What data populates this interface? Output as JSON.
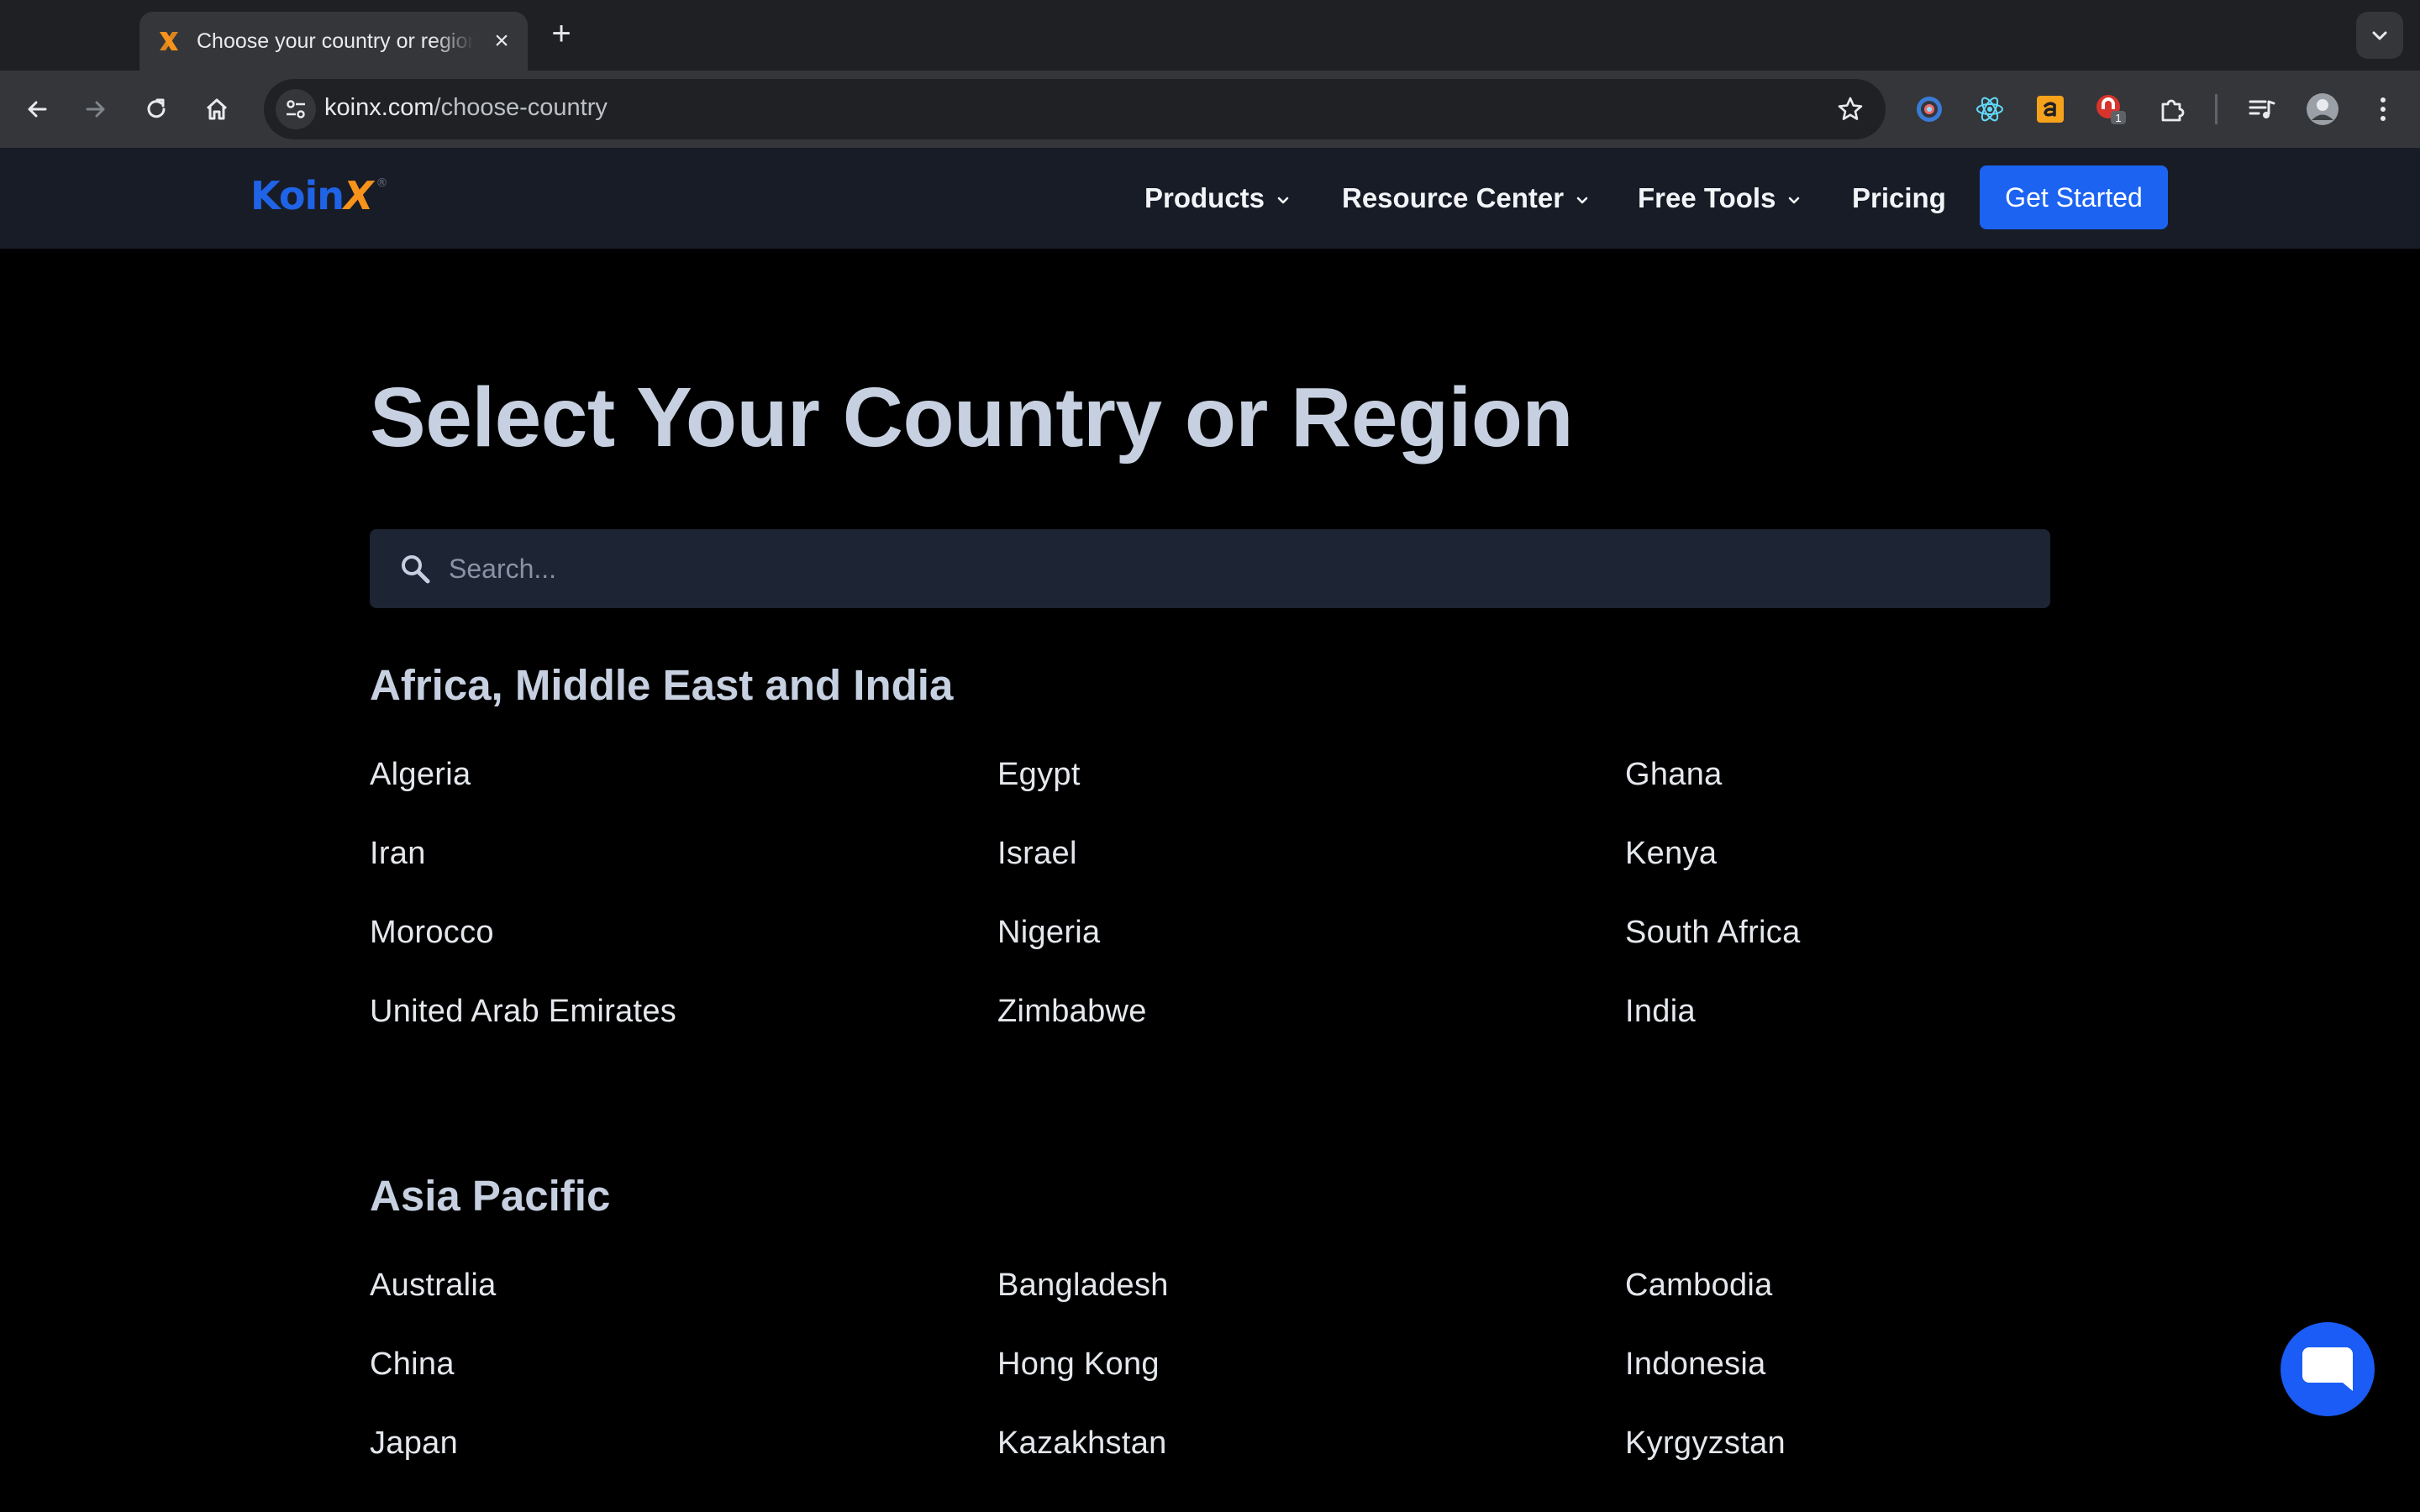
{
  "browser": {
    "tab_title": "Choose your country or region | KoinX",
    "new_tab_symbol": "+",
    "url_host": "koinx.com",
    "url_path": "/choose-country",
    "extension_badge": "1",
    "colors": {
      "tabstrip": "#1f2024",
      "toolbar": "#35363a",
      "omnibox": "#202124"
    }
  },
  "header": {
    "logo_main": "Koin",
    "logo_x": "X",
    "logo_mark": "®",
    "nav": [
      {
        "label": "Products",
        "dropdown": true
      },
      {
        "label": "Resource Center",
        "dropdown": true
      },
      {
        "label": "Free Tools",
        "dropdown": true
      },
      {
        "label": "Pricing",
        "dropdown": false
      }
    ],
    "cta_label": "Get Started",
    "colors": {
      "brand_blue": "#1f63e6",
      "brand_orange": "#f7931a",
      "cta": "#1c63f2"
    }
  },
  "main": {
    "title": "Select Your Country or Region",
    "search_placeholder": "Search...",
    "regions": [
      {
        "name": "Africa, Middle East and India",
        "countries": [
          "Algeria",
          "Egypt",
          "Ghana",
          "Iran",
          "Israel",
          "Kenya",
          "Morocco",
          "Nigeria",
          "South Africa",
          "United Arab Emirates",
          "Zimbabwe",
          "India"
        ]
      },
      {
        "name": "Asia Pacific",
        "countries": [
          "Australia",
          "Bangladesh",
          "Cambodia",
          "China",
          "Hong Kong",
          "Indonesia",
          "Japan",
          "Kazakhstan",
          "Kyrgyzstan"
        ]
      }
    ]
  },
  "icons": {
    "back": "arrow-left-icon",
    "forward": "arrow-right-icon",
    "reload": "reload-icon",
    "home": "home-icon",
    "site_settings": "tune-icon",
    "bookmark": "star-icon",
    "search": "search-icon",
    "chat": "chat-bubble-icon"
  }
}
